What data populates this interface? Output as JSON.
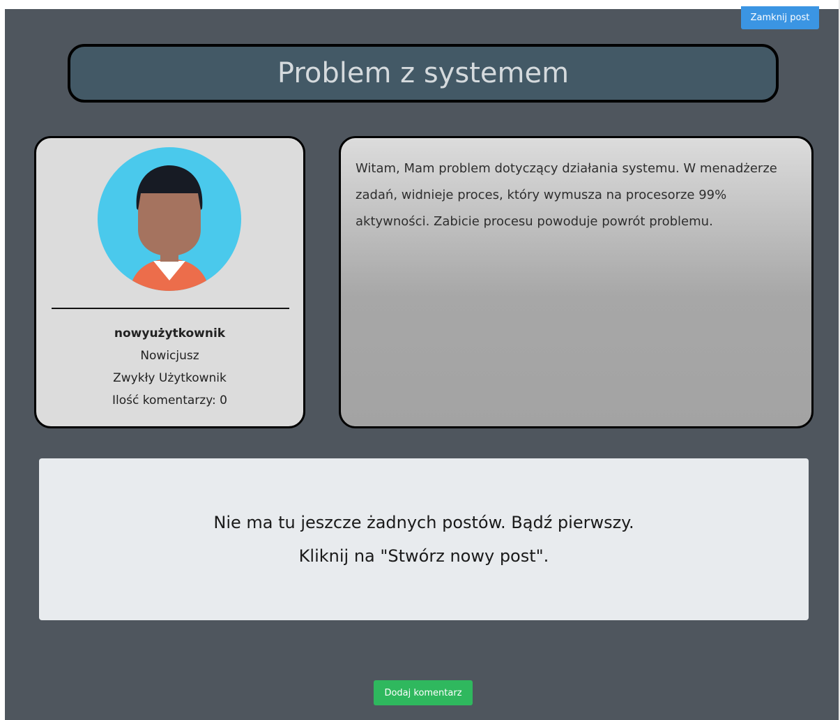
{
  "toolbar": {
    "close_label": "Zamknij post"
  },
  "post": {
    "title": "Problem z systemem",
    "content": "Witam, Mam problem dotyczący działania systemu. W menadżerze zadań, widnieje proces, który wymusza na procesorze 99% aktywności. Zabicie procesu powoduje powrót problemu."
  },
  "author": {
    "username": "nowyużytkownik",
    "rank": "Nowicjusz",
    "role": "Zwykły Użytkownik",
    "comments_count": "Ilość komentarzy: 0",
    "avatar_icon": "user-avatar-icon"
  },
  "comments": {
    "empty_line1": "Nie ma tu jeszcze żadnych postów. Bądź pierwszy.",
    "empty_line2": "Kliknij na \"Stwórz nowy post\"."
  },
  "footer": {
    "add_comment_label": "Dodaj komentarz"
  },
  "colors": {
    "background": "#4f565e",
    "title_bg": "#435966",
    "close_button": "#3b95e3",
    "add_button": "#2fb85e",
    "avatar_circle": "#4ac9ec",
    "avatar_shirt": "#ec6d4b"
  }
}
